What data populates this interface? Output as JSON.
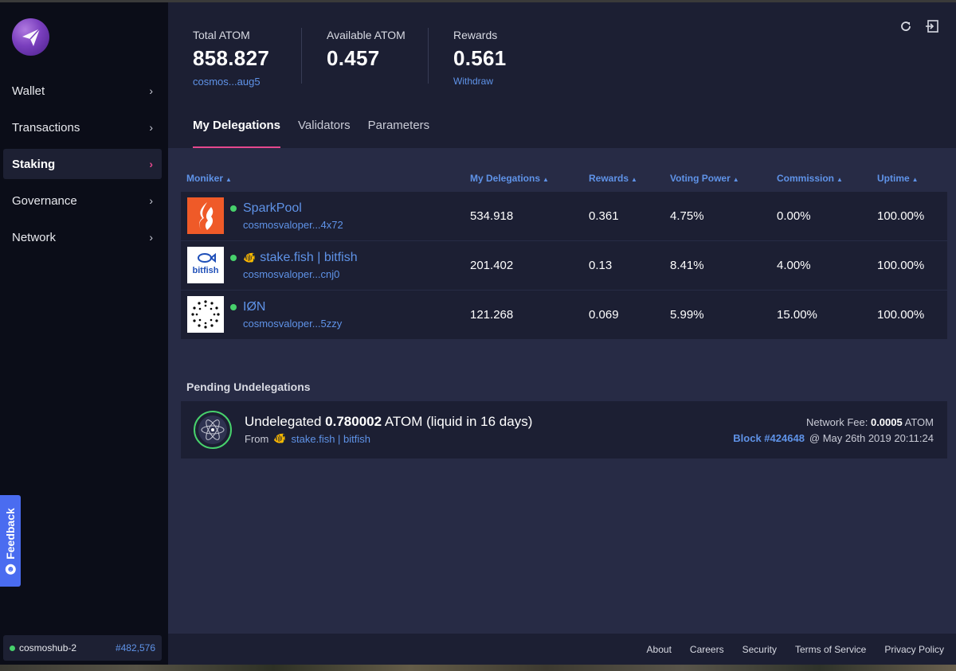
{
  "sidebar": {
    "items": [
      {
        "label": "Wallet"
      },
      {
        "label": "Transactions"
      },
      {
        "label": "Staking"
      },
      {
        "label": "Governance"
      },
      {
        "label": "Network"
      }
    ],
    "active": "Staking",
    "chevron": "›",
    "network": {
      "chain": "cosmoshub-2",
      "block": "#482,576"
    },
    "feedback": "Feedback"
  },
  "header": {
    "total": {
      "label": "Total ATOM",
      "value": "858.827",
      "link": "cosmos...aug5"
    },
    "available": {
      "label": "Available ATOM",
      "value": "0.457"
    },
    "rewards": {
      "label": "Rewards",
      "value": "0.561",
      "link": "Withdraw"
    },
    "icons": [
      "refresh-icon",
      "sign-out-icon"
    ]
  },
  "tabs": [
    {
      "label": "My Delegations"
    },
    {
      "label": "Validators"
    },
    {
      "label": "Parameters"
    }
  ],
  "table": {
    "columns": [
      "Moniker",
      "My Delegations",
      "Rewards",
      "Voting Power",
      "Commission",
      "Uptime"
    ],
    "sort_arrow": "▲",
    "rows": [
      {
        "name": "SparkPool",
        "address": "cosmosvaloper...4x72",
        "delegation": "534.918",
        "rewards": "0.361",
        "voting_power": "4.75%",
        "commission": "0.00%",
        "uptime": "100.00%"
      },
      {
        "name": "stake.fish | bitfish",
        "address": "cosmosvaloper...cnj0",
        "delegation": "201.402",
        "rewards": "0.13",
        "voting_power": "8.41%",
        "commission": "4.00%",
        "uptime": "100.00%"
      },
      {
        "name": "IØN",
        "address": "cosmosvaloper...5zzy",
        "delegation": "121.268",
        "rewards": "0.069",
        "voting_power": "5.99%",
        "commission": "15.00%",
        "uptime": "100.00%"
      }
    ],
    "bitfish_logo_text": "bitfish"
  },
  "pending": {
    "title": "Pending Undelegations",
    "item": {
      "prefix": "Undelegated",
      "amount": "0.780002",
      "suffix": "ATOM (liquid in 16 days)",
      "from_label": "From",
      "validator": "stake.fish | bitfish",
      "fee_label": "Network Fee:",
      "fee_value": "0.0005",
      "fee_unit": "ATOM",
      "block": "Block #424648",
      "time": "@ May 26th 2019 20:11:24"
    }
  },
  "footer": {
    "links": [
      "About",
      "Careers",
      "Security",
      "Terms of Service",
      "Privacy Policy"
    ]
  },
  "colors": {
    "accent": "#5f93e8",
    "active_tab": "#e5488d",
    "status_green": "#47d16c"
  }
}
